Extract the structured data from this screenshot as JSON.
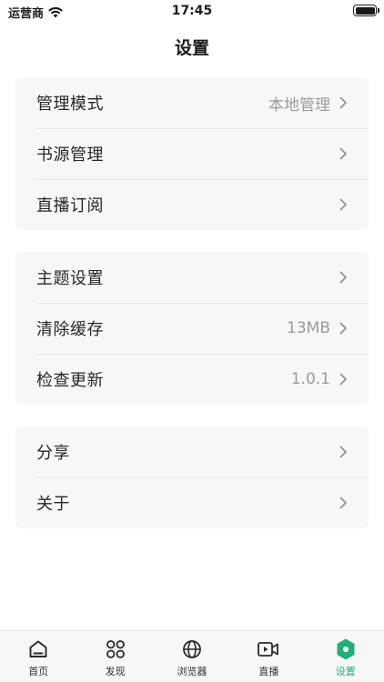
{
  "status_bar": {
    "carrier": "运营商",
    "time": "17:45"
  },
  "header": {
    "title": "设置"
  },
  "groups": [
    {
      "items": [
        {
          "label": "管理模式",
          "value": "本地管理"
        },
        {
          "label": "书源管理",
          "value": ""
        },
        {
          "label": "直播订阅",
          "value": ""
        }
      ]
    },
    {
      "items": [
        {
          "label": "主题设置",
          "value": ""
        },
        {
          "label": "清除缓存",
          "value": "13MB"
        },
        {
          "label": "检查更新",
          "value": "1.0.1"
        }
      ]
    },
    {
      "items": [
        {
          "label": "分享",
          "value": ""
        },
        {
          "label": "关于",
          "value": ""
        }
      ]
    }
  ],
  "tab_bar": {
    "tabs": [
      {
        "label": "首页",
        "icon": "home-icon"
      },
      {
        "label": "发现",
        "icon": "discover-icon"
      },
      {
        "label": "浏览器",
        "icon": "globe-icon"
      },
      {
        "label": "直播",
        "icon": "video-icon"
      },
      {
        "label": "设置",
        "icon": "settings-icon",
        "active": true
      }
    ]
  },
  "colors": {
    "accent": "#1fb07a",
    "card_bg": "#f6f7f8",
    "value_text": "#9a9a9a"
  }
}
